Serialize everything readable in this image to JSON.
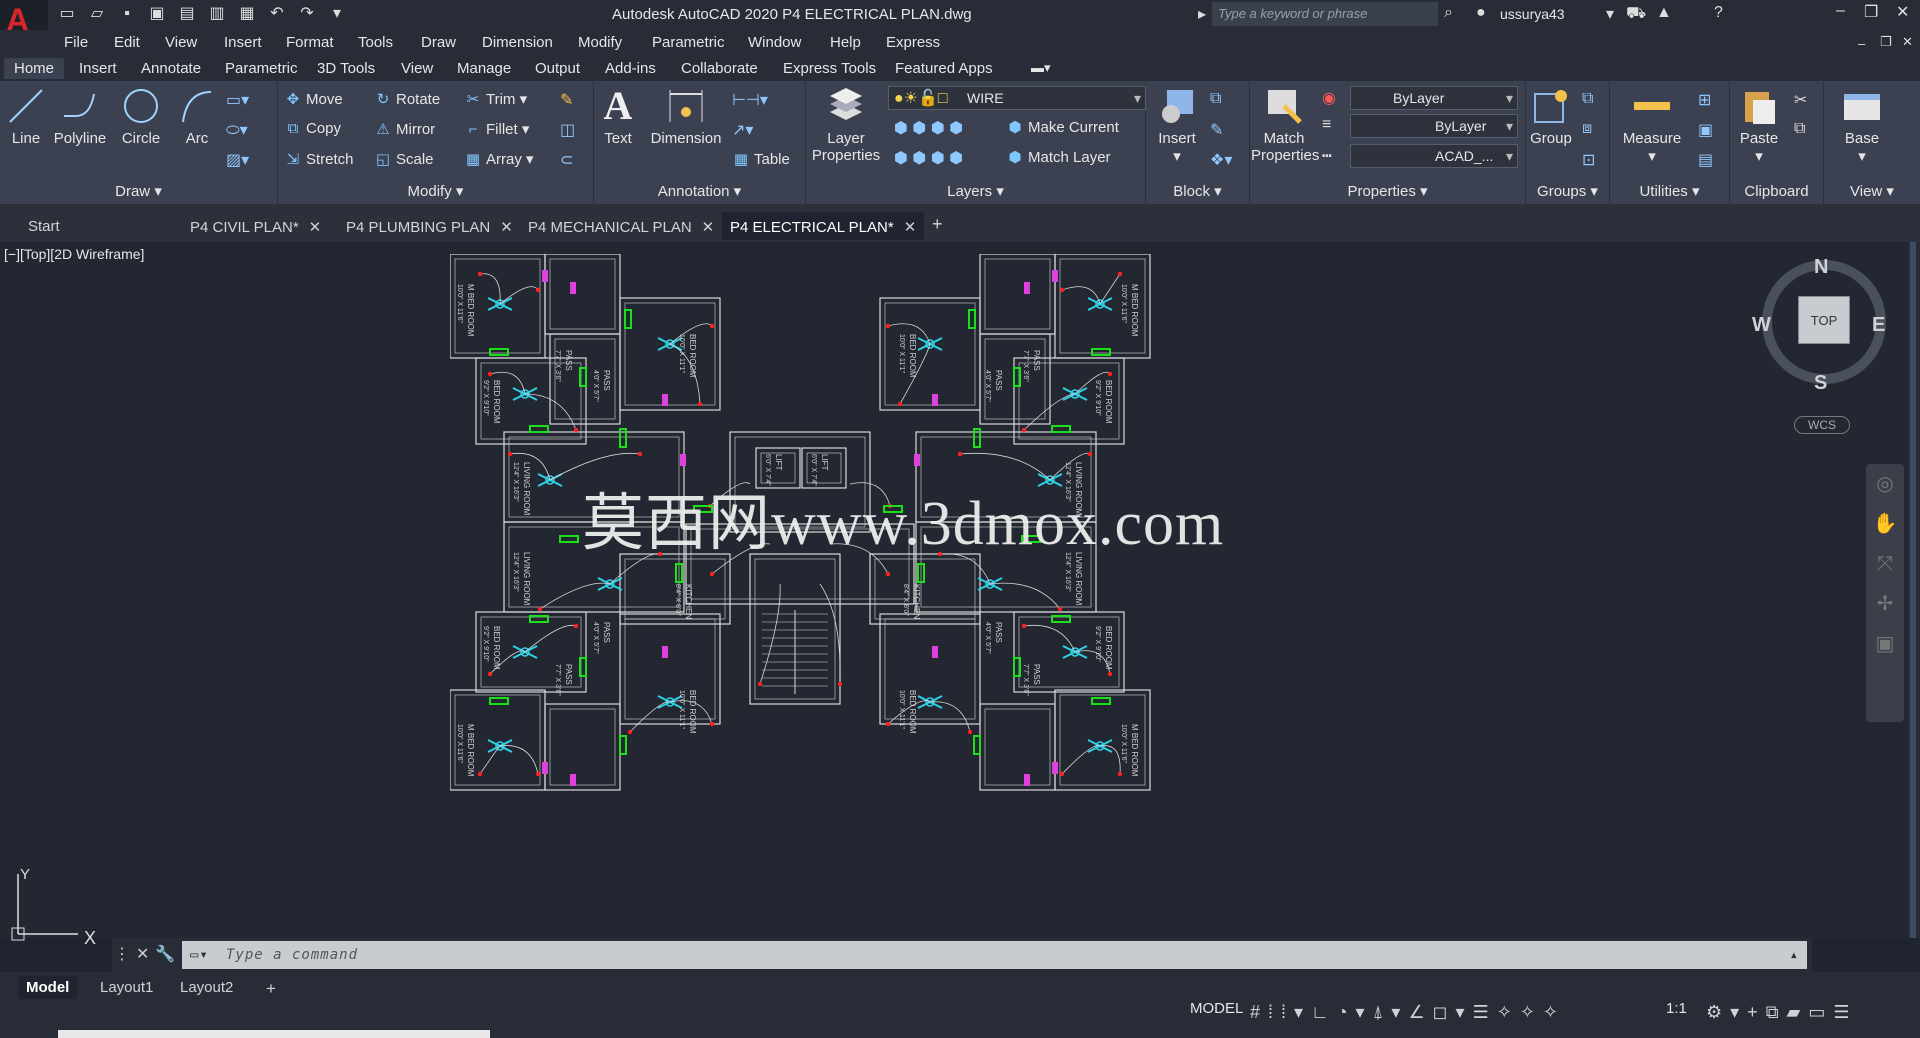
{
  "app": {
    "logo": "A",
    "title": "Autodesk AutoCAD 2020    P4 ELECTRICAL PLAN.dwg",
    "search_placeholder": "Type a keyword or phrase",
    "user": "ussurya43"
  },
  "menu": [
    "File",
    "Edit",
    "View",
    "Insert",
    "Format",
    "Tools",
    "Draw",
    "Dimension",
    "Modify",
    "Parametric",
    "Window",
    "Help",
    "Express"
  ],
  "ribbon_tabs": [
    "Home",
    "Insert",
    "Annotate",
    "Parametric",
    "3D Tools",
    "View",
    "Manage",
    "Output",
    "Add-ins",
    "Collaborate",
    "Express Tools",
    "Featured Apps"
  ],
  "ribbon": {
    "draw": {
      "title": "Draw",
      "line": "Line",
      "polyline": "Polyline",
      "circle": "Circle",
      "arc": "Arc"
    },
    "modify": {
      "title": "Modify",
      "move": "Move",
      "rotate": "Rotate",
      "trim": "Trim",
      "copy": "Copy",
      "mirror": "Mirror",
      "fillet": "Fillet",
      "stretch": "Stretch",
      "scale": "Scale",
      "array": "Array"
    },
    "annotation": {
      "title": "Annotation",
      "text": "Text",
      "dimension": "Dimension",
      "table": "Table"
    },
    "layers": {
      "title": "Layers",
      "layer_properties": "Layer Properties",
      "current_layer": "WIRE",
      "make_current": "Make Current",
      "match_layer": "Match Layer"
    },
    "block": {
      "title": "Block",
      "insert": "Insert"
    },
    "properties": {
      "title": "Properties",
      "match_properties": "Match Properties",
      "color": "ByLayer",
      "linetype": "ByLayer",
      "lineweight": "ACAD_..."
    },
    "groups": {
      "title": "Groups",
      "group": "Group"
    },
    "utilities": {
      "title": "Utilities",
      "measure": "Measure"
    },
    "clipboard": {
      "title": "Clipboard",
      "paste": "Paste"
    },
    "view": {
      "title": "View",
      "base": "Base"
    }
  },
  "doc_tabs": [
    {
      "label": "Start"
    },
    {
      "label": "P4 CIVIL PLAN*"
    },
    {
      "label": "P4 PLUMBING PLAN"
    },
    {
      "label": "P4 MECHANICAL PLAN"
    },
    {
      "label": "P4 ELECTRICAL PLAN*"
    }
  ],
  "viewport": {
    "label": "[−][Top][2D Wireframe]",
    "watermark": "莫西网www.3dmox.com",
    "viewcube": {
      "top": "TOP",
      "n": "N",
      "s": "S",
      "e": "E",
      "w": "W",
      "wcs": "WCS"
    },
    "ucs": {
      "y": "Y",
      "x": "X"
    }
  },
  "plan_labels": {
    "master_bed": "M BED ROOM",
    "master_bed_size": "10'0\" X 11'6\"",
    "bed": "BED ROOM",
    "bed_size": "9'2\" X 9'10\"",
    "bed2": "BED ROOM",
    "bed2_size": "10'0\" X 11'1\"",
    "living": "LIVING ROOM",
    "living_size": "12'4\" X 16'3\"",
    "kitchen": "KITCHEN",
    "kitchen_size": "8'4\" X 8'0\"",
    "pass": "PASS",
    "pass_size": "7'7\" X 3'6\"",
    "pass2": "PASS",
    "pass2_size": "4'0\" X 5'7\"",
    "lift": "LIFT",
    "lift_size": "6'0\" X 7'4\""
  },
  "command": {
    "placeholder": "Type a command"
  },
  "layout_tabs": [
    "Model",
    "Layout1",
    "Layout2"
  ],
  "status": {
    "model": "MODEL",
    "scale": "1:1"
  },
  "colors": {
    "wire": "#d9d9d9",
    "fixture_green": "#19e019",
    "fixture_cyan": "#2fd2e8",
    "switch_magenta": "#e040e0",
    "point_red": "#ff2020"
  }
}
